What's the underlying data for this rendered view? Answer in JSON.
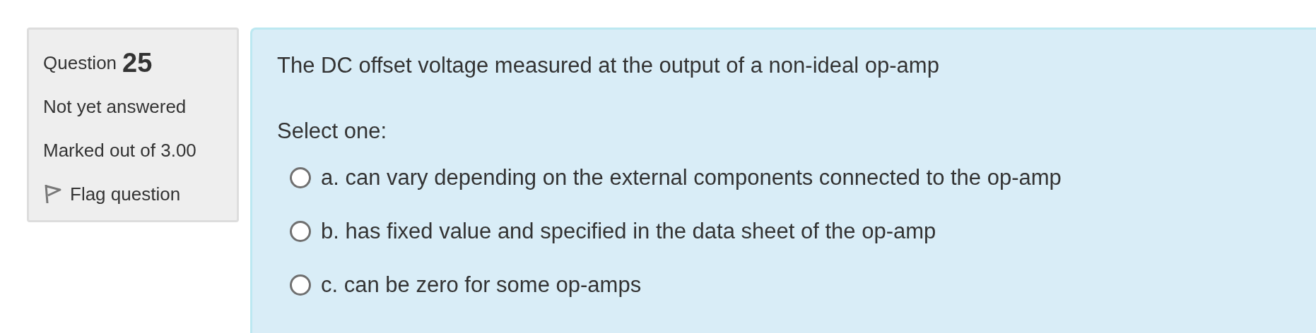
{
  "info": {
    "label": "Question",
    "number": "25",
    "state": "Not yet answered",
    "marks": "Marked out of 3.00",
    "flag": {
      "label": "Flag question",
      "flagged": false
    }
  },
  "question": {
    "text": "The DC offset voltage measured at the output of a non-ideal op-amp",
    "prompt": "Select one:",
    "options": [
      {
        "label": "a. can vary depending on the external components connected to the op-amp",
        "selected": false
      },
      {
        "label": "b. has fixed value and specified in the data sheet of the op-amp",
        "selected": false
      },
      {
        "label": "c. can be zero for some op-amps",
        "selected": false
      }
    ]
  }
}
